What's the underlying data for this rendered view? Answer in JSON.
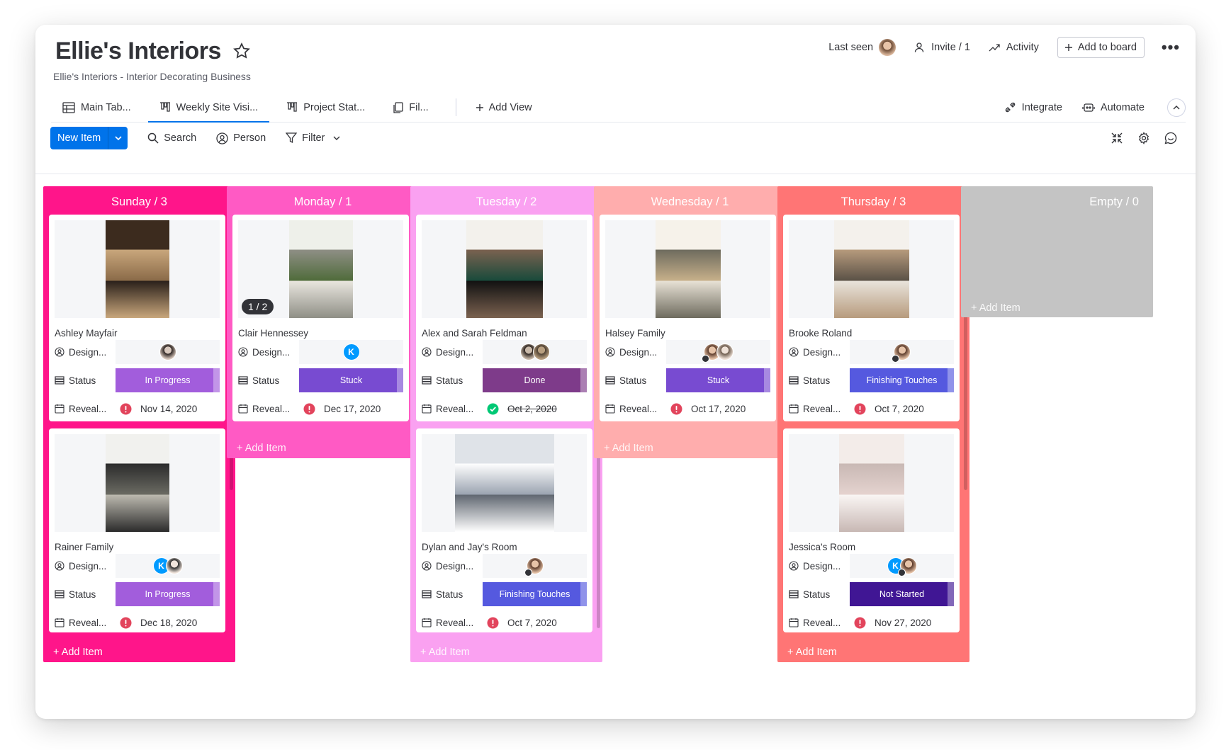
{
  "board": {
    "title": "Ellie's Interiors",
    "subtitle": "Ellie's Interiors - Interior Decorating Business"
  },
  "header": {
    "last_seen": "Last seen",
    "invite": "Invite / 1",
    "activity": "Activity",
    "add_to_board": "Add to board",
    "more": "•••"
  },
  "tabs": {
    "items": [
      {
        "label": "Main Tab...",
        "icon": "table-icon"
      },
      {
        "label": "Weekly Site Visi...",
        "icon": "kanban-icon",
        "active": true
      },
      {
        "label": "Project Stat...",
        "icon": "kanban-icon"
      },
      {
        "label": "Fil...",
        "icon": "file-icon"
      }
    ],
    "add_view": "Add View",
    "integrate": "Integrate",
    "automate": "Automate"
  },
  "toolbar": {
    "new_item": "New Item",
    "search": "Search",
    "person": "Person",
    "filter": "Filter"
  },
  "colors": {
    "sunday": "#ff158a",
    "monday": "#ff5ac4",
    "tuesday": "#faa1f1",
    "wednesday": "#ffadad",
    "thursday": "#ff7575",
    "empty": "#c4c4c4",
    "in_progress": "#a25ddc",
    "stuck": "#784bd1",
    "done": "#7e3b8a",
    "finishing": "#5559df",
    "not_started": "#401694",
    "overdue": "#e2445c",
    "complete": "#00c875"
  },
  "field_labels": {
    "designer": "Design...",
    "status": "Status",
    "reveal": "Reveal..."
  },
  "columns": [
    {
      "header": "Sunday / 3",
      "add_item": "+ Add Item",
      "cards": [
        {
          "name": "Ashley Mayfair",
          "status": "In Progress",
          "date": "Nov 14, 2020"
        },
        {
          "name": "Rainer Family",
          "status": "In Progress",
          "date": "Dec 18, 2020",
          "avatar_letter": "K"
        }
      ]
    },
    {
      "header": "Monday / 1",
      "add_item": "+ Add Item",
      "cards": [
        {
          "name": "Clair Hennessey",
          "status": "Stuck",
          "date": "Dec 17, 2020",
          "pager": "1 / 2",
          "avatar_letter": "K"
        }
      ]
    },
    {
      "header": "Tuesday / 2",
      "add_item": "+ Add Item",
      "cards": [
        {
          "name": "Alex and Sarah Feldman",
          "status": "Done",
          "date": "Oct 2, 2020"
        },
        {
          "name": "Dylan and Jay's Room",
          "status": "Finishing Touches",
          "date": "Oct 7, 2020"
        }
      ]
    },
    {
      "header": "Wednesday / 1",
      "add_item": "+ Add Item",
      "cards": [
        {
          "name": "Halsey Family",
          "status": "Stuck",
          "date": "Oct 17, 2020"
        }
      ]
    },
    {
      "header": "Thursday / 3",
      "add_item": "+ Add Item",
      "cards": [
        {
          "name": "Brooke Roland",
          "status": "Finishing Touches",
          "date": "Oct 7, 2020"
        },
        {
          "name": "Jessica's Room",
          "status": "Not Started",
          "date": "Nov 27, 2020",
          "avatar_letter": "K"
        }
      ]
    },
    {
      "header": "Empty / 0",
      "add_item": "+ Add Item",
      "cards": []
    }
  ]
}
